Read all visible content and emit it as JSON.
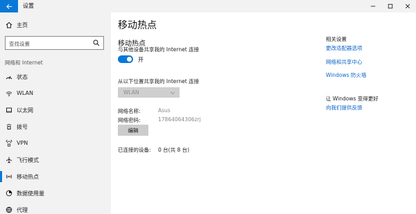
{
  "window": {
    "title": "设置",
    "controls": {
      "minimize": "minimize-icon",
      "maximize": "maximize-icon",
      "close": "close-icon"
    }
  },
  "sidebar": {
    "home_label": "主页",
    "search_placeholder": "查找设置",
    "section_label": "网络和 Internet",
    "items": [
      {
        "label": "状态",
        "icon": "status-icon"
      },
      {
        "label": "WLAN",
        "icon": "wifi-icon"
      },
      {
        "label": "以太网",
        "icon": "ethernet-icon"
      },
      {
        "label": "拨号",
        "icon": "dialup-icon"
      },
      {
        "label": "VPN",
        "icon": "vpn-icon"
      },
      {
        "label": "飞行模式",
        "icon": "airplane-icon"
      },
      {
        "label": "移动热点",
        "icon": "hotspot-icon",
        "selected": true
      },
      {
        "label": "数据使用量",
        "icon": "data-usage-icon"
      },
      {
        "label": "代理",
        "icon": "proxy-icon"
      }
    ]
  },
  "main": {
    "page_title": "移动热点",
    "section_title": "移动热点",
    "share_description": "与其他设备共享我的 Internet 连接",
    "toggle_label": "开",
    "toggle_on": true,
    "share_from_label": "从以下位置共享我的 Internet 连接",
    "share_from_value": "WLAN",
    "network_name_label": "网络名称:",
    "network_name_value": "Asus",
    "network_password_label": "网络密码:",
    "network_password_value": "17864064306zrj",
    "edit_button": "编辑",
    "connected_label": "已连接的设备:",
    "connected_value": "0 台(共 8 台)"
  },
  "related": {
    "title": "相关设置",
    "links": [
      "更改适配器选项",
      "网络和共享中心",
      "Windows 防火墙"
    ],
    "improve_title": "让 Windows 变得更好",
    "feedback_link": "向我们提供反馈"
  },
  "colors": {
    "accent": "#0a78d7",
    "link": "#0a64c8",
    "sidebar_bg": "#f2f2f2"
  }
}
